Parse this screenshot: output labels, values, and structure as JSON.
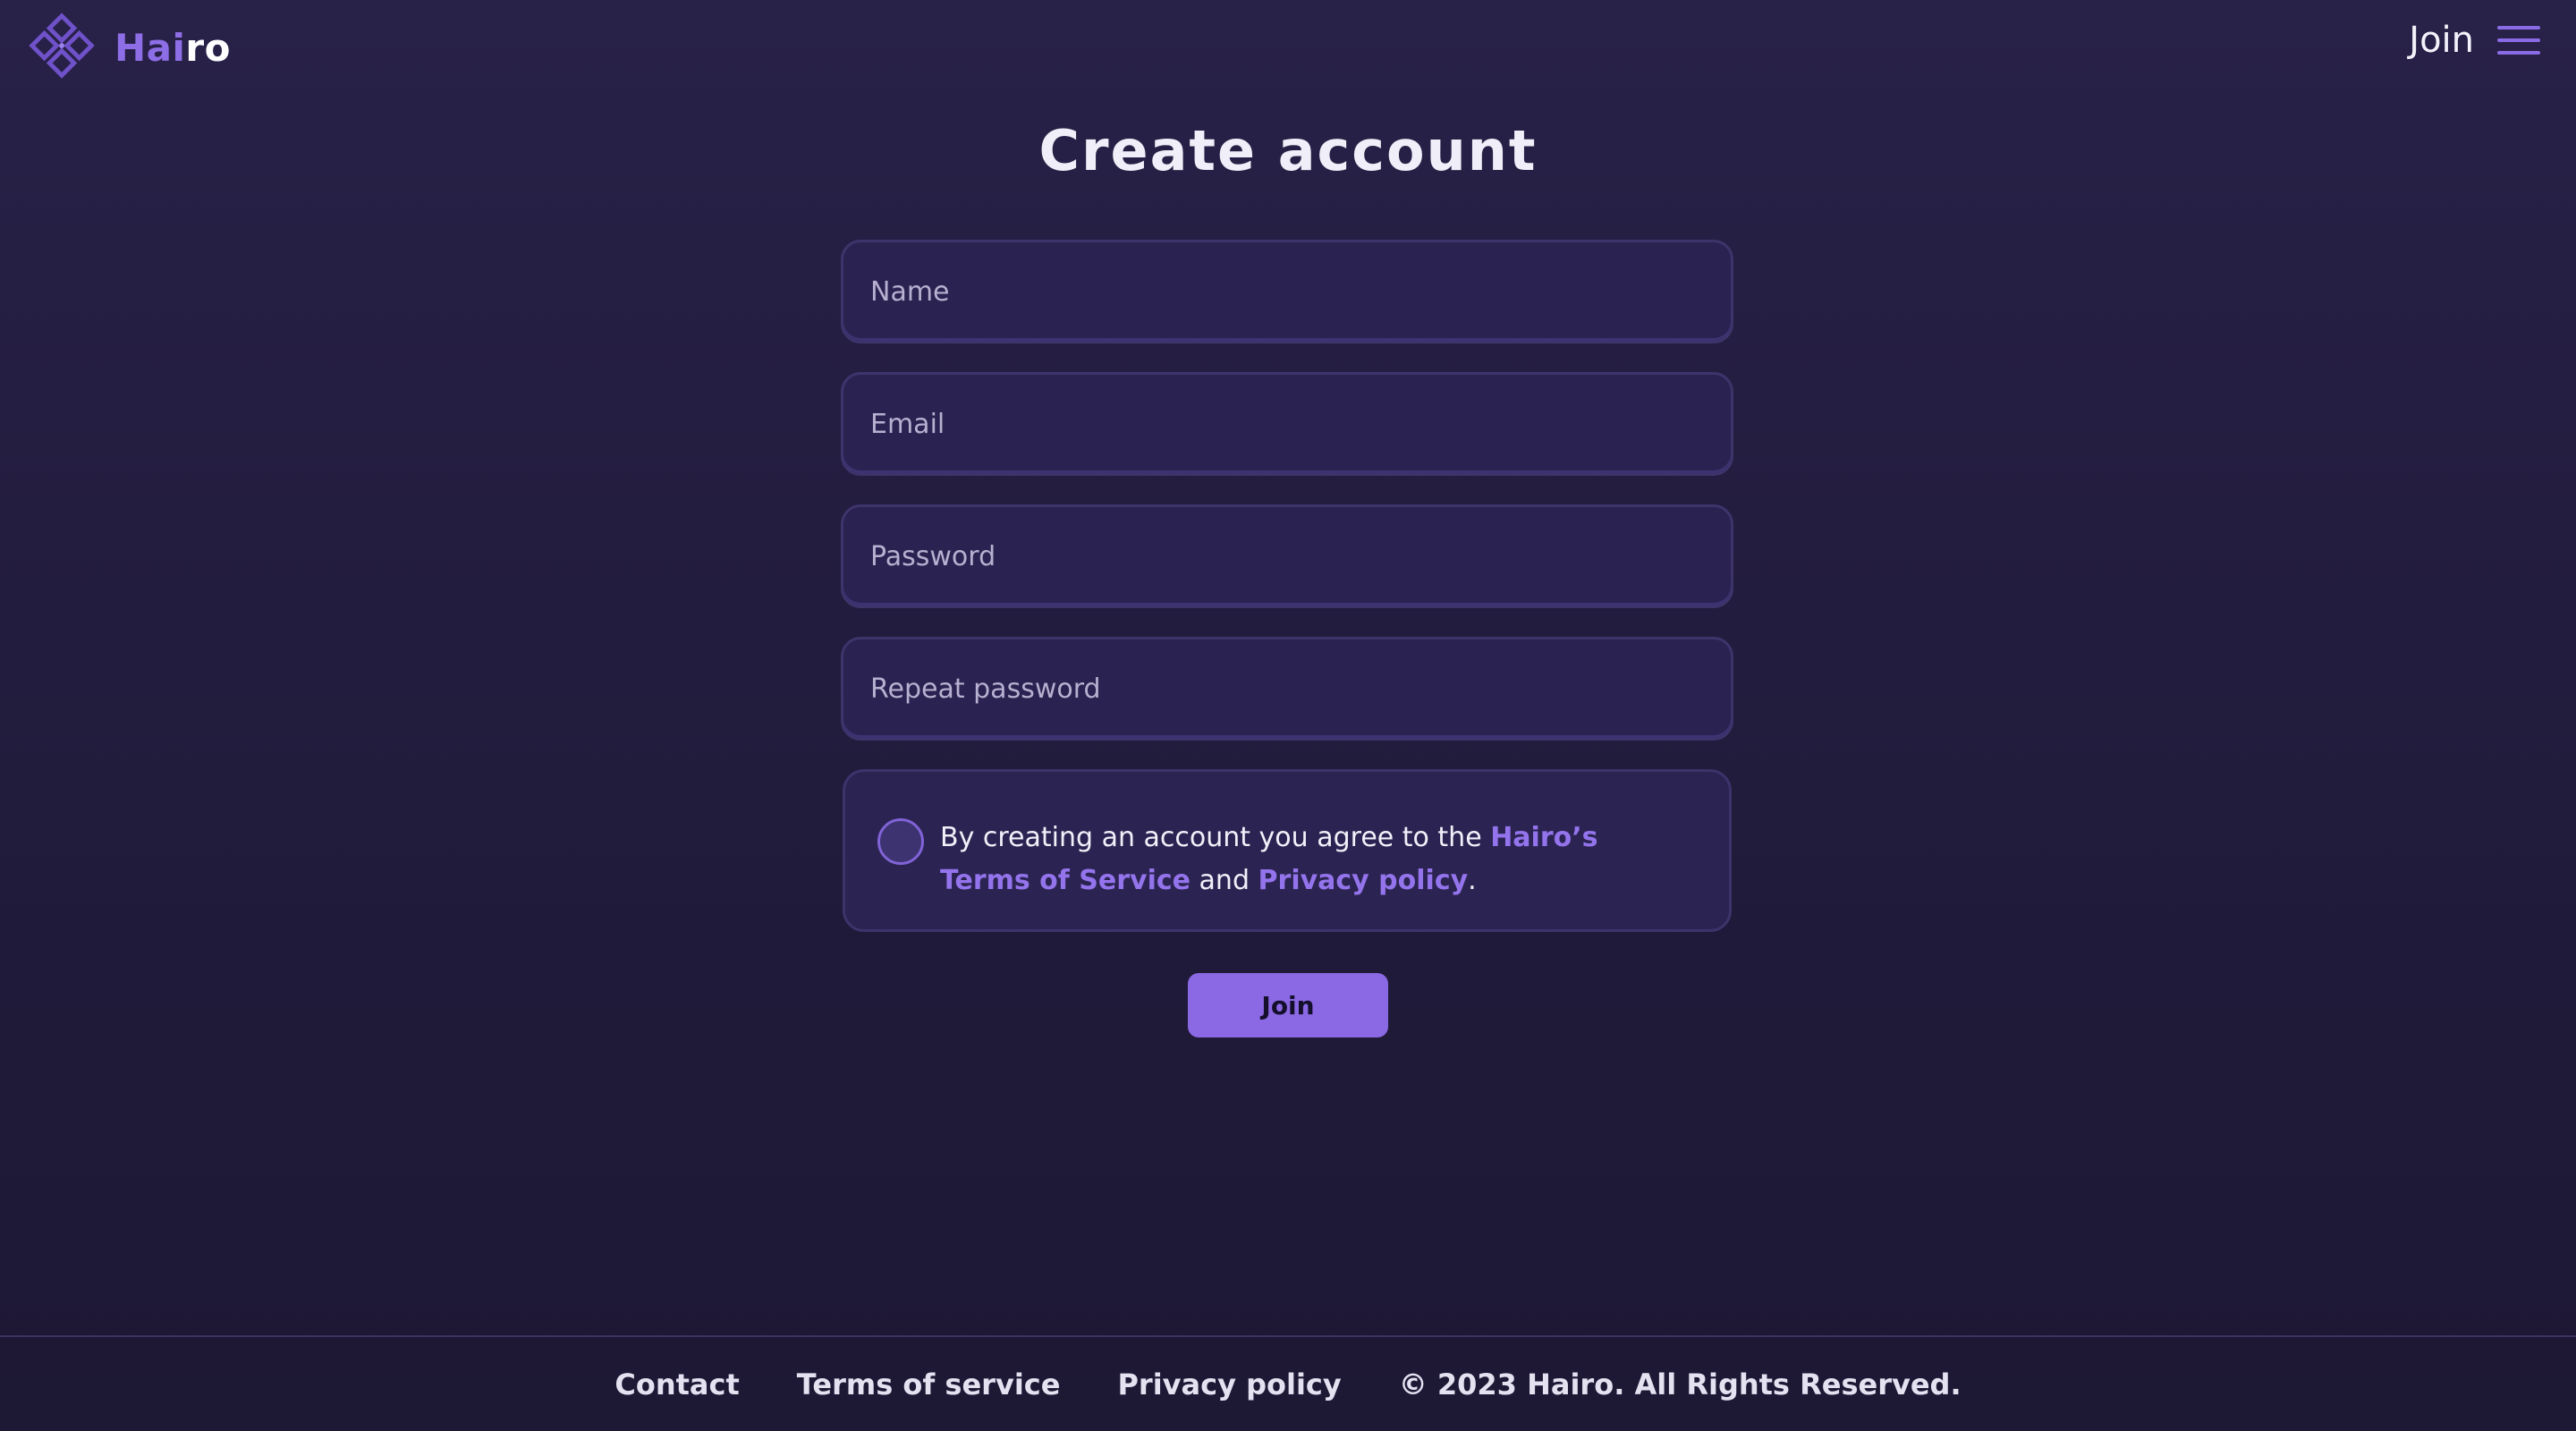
{
  "brand": {
    "name_accent": "Hai",
    "name_rest": "ro",
    "logo_icon": "diamond-logo-icon",
    "accent_color": "#8d6ee6"
  },
  "header": {
    "join_label": "Join",
    "menu_icon": "hamburger-menu-icon"
  },
  "page": {
    "title": "Create account"
  },
  "form": {
    "name_placeholder": "Name",
    "email_placeholder": "Email",
    "password_placeholder": "Password",
    "repeat_password_placeholder": "Repeat password",
    "terms": {
      "checked": false,
      "prefix": "By creating an account you agree to the ",
      "terms_link": "Hairo’s Terms of Service",
      "middle": " and ",
      "privacy_link": "Privacy policy",
      "suffix": "."
    },
    "submit_label": "Join"
  },
  "footer": {
    "contact": "Contact",
    "terms": "Terms of service",
    "privacy": "Privacy policy",
    "copyright": "© 2023 Hairo. All Rights Reserved."
  },
  "colors": {
    "background": "#221c3e",
    "input_background": "#2a2250",
    "button": "#8b68e4",
    "link": "#9474ec"
  }
}
